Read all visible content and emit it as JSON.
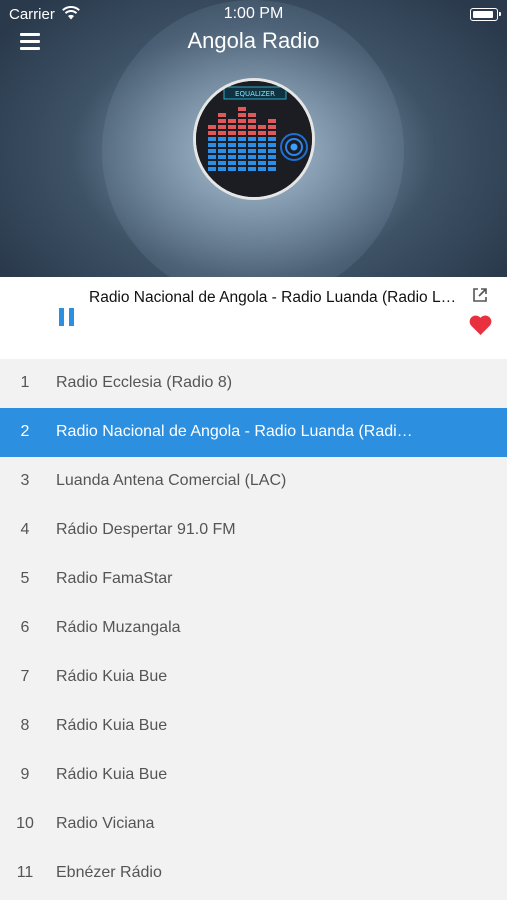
{
  "status_bar": {
    "carrier": "Carrier",
    "time": "1:00 PM"
  },
  "header": {
    "title": "Angola Radio",
    "artwork_label": "EQUALIZER"
  },
  "now_playing": {
    "title": "Radio Nacional de Angola - Radio Luanda (Radio Luanda)",
    "state": "playing"
  },
  "stations": [
    {
      "num": "1",
      "name": "Radio Ecclesia (Radio 8)",
      "active": false
    },
    {
      "num": "2",
      "name": "Radio Nacional de Angola - Radio Luanda (Radio Luanda)",
      "active": true
    },
    {
      "num": "3",
      "name": "Luanda Antena Comercial (LAC)",
      "active": false
    },
    {
      "num": "4",
      "name": "Rádio Despertar 91.0 FM",
      "active": false
    },
    {
      "num": "5",
      "name": "Radio FamaStar",
      "active": false
    },
    {
      "num": "6",
      "name": "Rádio Muzangala",
      "active": false
    },
    {
      "num": "7",
      "name": "Rádio Kuia Bue",
      "active": false
    },
    {
      "num": "8",
      "name": "Rádio Kuia Bue",
      "active": false
    },
    {
      "num": "9",
      "name": "Rádio Kuia Bue",
      "active": false
    },
    {
      "num": "10",
      "name": "Radio Viciana",
      "active": false
    },
    {
      "num": "11",
      "name": "Ebnézer Rádio",
      "active": false
    }
  ],
  "colors": {
    "accent": "#2d8fe0",
    "heart": "#e8303f",
    "list_bg": "#f2f2f2"
  },
  "icons": {
    "menu": "hamburger-icon",
    "play_state": "pause-icon",
    "share": "share-icon",
    "favorite": "heart-icon"
  }
}
